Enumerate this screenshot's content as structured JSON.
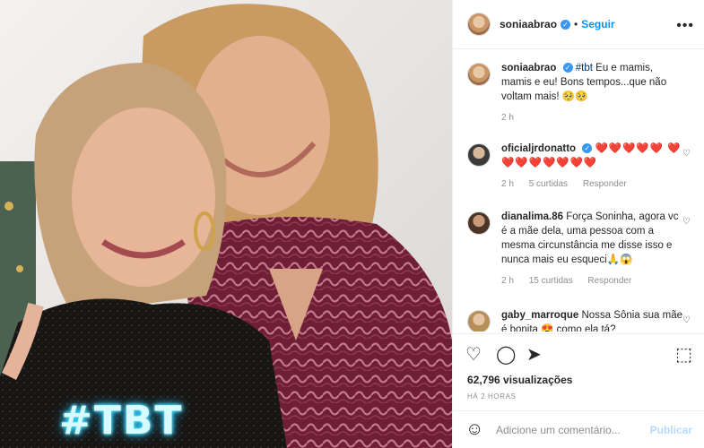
{
  "photo": {
    "overlay_text": "#TBT"
  },
  "header": {
    "username": "soniaabrao",
    "separator": "•",
    "follow_label": "Seguir",
    "more_icon": "more-icon"
  },
  "caption": {
    "username": "soniaabrao",
    "hashtag": "#tbt",
    "text": " Eu e mamis, mamis e eu! Bons tempos...que não voltam mais! 🥺🥺",
    "time": "2 h"
  },
  "comments": [
    {
      "username": "oficialjrdonatto",
      "text": "❤️❤️❤️❤️❤️ ❤️❤️❤️❤️❤️❤️❤️❤️",
      "time": "2 h",
      "likes": "5 curtidas",
      "reply": "Responder"
    },
    {
      "username": "dianalima.86",
      "text": " Força Soninha, agora vc é a mãe dela, uma pessoa com a mesma circunstância me disse isso e nunca mais eu esqueci🙏😱",
      "time": "2 h",
      "likes": "15 curtidas",
      "reply": "Responder"
    },
    {
      "username": "gaby_marroque",
      "text": " Nossa Sônia sua mãe é bonita 😍 como ela tá?"
    }
  ],
  "stats": {
    "views": "62,796 visualizações",
    "posted": "HÁ 2 HORAS"
  },
  "add_comment": {
    "placeholder": "Adicione um comentário...",
    "publish_label": "Publicar"
  },
  "colors": {
    "accent": "#0095f6",
    "verified": "#3897f0",
    "heart": "#ed1c24"
  }
}
